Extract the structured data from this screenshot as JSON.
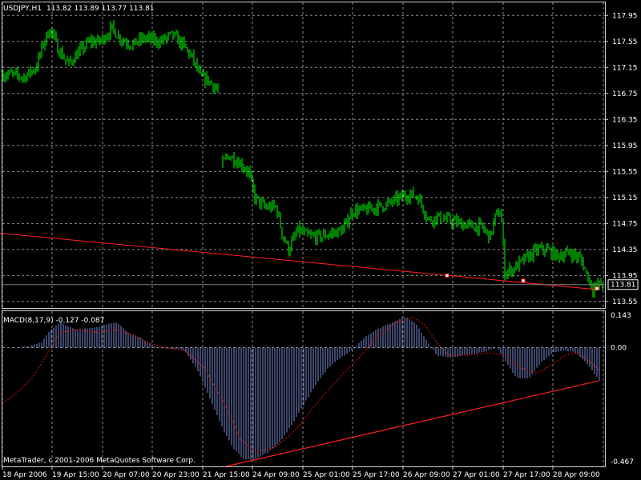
{
  "colors": {
    "background": "#000000",
    "grid": "#8a8a8a",
    "frame": "#cfcfcf",
    "price_bars": "#00ff00",
    "trendline": "#ff2020",
    "macd_histogram": "#7b8bd6",
    "macd_signal": "#e01010",
    "text": "#ffffff"
  },
  "chart_data": [
    {
      "type": "line",
      "title": "USDJPY,H1",
      "ohlc": "113.82 113.89 113.77 113.81",
      "ylim": [
        113.45,
        118.15
      ],
      "y_ticks": [
        "117.95",
        "117.55",
        "117.15",
        "116.75",
        "116.35",
        "115.95",
        "115.55",
        "115.15",
        "114.75",
        "114.35",
        "113.95",
        "113.55"
      ],
      "current_price": "113.81",
      "x_ticks": [
        "18 Apr 2006",
        "19 Apr 15:00",
        "20 Apr 07:00",
        "20 Apr 23:00",
        "21 Apr 15:00",
        "24 Apr 09:00",
        "25 Apr 01:00",
        "25 Apr 17:00",
        "26 Apr 09:00",
        "27 Apr 01:00",
        "27 Apr 17:00",
        "28 Apr 09:00"
      ],
      "grid": true,
      "close_path": [
        [
          0,
          117.03
        ],
        [
          10,
          117.05
        ],
        [
          30,
          117.0
        ],
        [
          45,
          117.15
        ],
        [
          55,
          117.55
        ],
        [
          63,
          117.75
        ],
        [
          72,
          117.45
        ],
        [
          85,
          117.2
        ],
        [
          100,
          117.4
        ],
        [
          112,
          117.55
        ],
        [
          125,
          117.55
        ],
        [
          140,
          117.75
        ],
        [
          150,
          117.6
        ],
        [
          165,
          117.5
        ],
        [
          180,
          117.6
        ],
        [
          200,
          117.55
        ],
        [
          215,
          117.65
        ],
        [
          228,
          117.5
        ],
        [
          240,
          117.3
        ],
        [
          250,
          117.0
        ],
        [
          260,
          116.95
        ],
        [
          272,
          116.8
        ],
        [
          277,
          115.65
        ],
        [
          285,
          115.8
        ],
        [
          298,
          115.7
        ],
        [
          310,
          115.55
        ],
        [
          318,
          115.15
        ],
        [
          330,
          115.0
        ],
        [
          345,
          115.0
        ],
        [
          352,
          114.6
        ],
        [
          360,
          114.35
        ],
        [
          372,
          114.65
        ],
        [
          385,
          114.55
        ],
        [
          400,
          114.55
        ],
        [
          415,
          114.6
        ],
        [
          428,
          114.65
        ],
        [
          440,
          114.95
        ],
        [
          455,
          114.95
        ],
        [
          470,
          115.0
        ],
        [
          485,
          115.05
        ],
        [
          500,
          115.15
        ],
        [
          512,
          115.2
        ],
        [
          522,
          115.15
        ],
        [
          535,
          114.8
        ],
        [
          545,
          114.85
        ],
        [
          560,
          114.8
        ],
        [
          575,
          114.75
        ],
        [
          590,
          114.7
        ],
        [
          600,
          114.7
        ],
        [
          612,
          114.55
        ],
        [
          618,
          114.85
        ],
        [
          625,
          114.95
        ],
        [
          630,
          114.0
        ],
        [
          640,
          114.05
        ],
        [
          655,
          114.2
        ],
        [
          672,
          114.35
        ],
        [
          682,
          114.35
        ],
        [
          695,
          114.25
        ],
        [
          712,
          114.3
        ],
        [
          725,
          114.2
        ],
        [
          733,
          113.95
        ],
        [
          740,
          113.75
        ],
        [
          746,
          113.8
        ],
        [
          752,
          113.82
        ]
      ],
      "trendline": [
        [
          0,
          114.6
        ],
        [
          748,
          113.73
        ]
      ],
      "trend_markers": [
        [
          558,
          113.95
        ],
        [
          653,
          113.87
        ],
        [
          745,
          113.75
        ]
      ]
    },
    {
      "type": "bar",
      "title": "MACD(8,17,9) -0.127 -0.087",
      "ylim": [
        -0.467,
        0.143
      ],
      "y_ticks": [
        "0.143",
        "0.00",
        "-0.467"
      ],
      "histogram_path": [
        [
          3,
          0.0
        ],
        [
          20,
          0.0
        ],
        [
          40,
          0.01
        ],
        [
          52,
          0.02
        ],
        [
          60,
          0.06
        ],
        [
          75,
          0.1
        ],
        [
          95,
          0.07
        ],
        [
          120,
          0.08
        ],
        [
          145,
          0.1
        ],
        [
          160,
          0.06
        ],
        [
          180,
          0.03
        ],
        [
          195,
          0.0
        ],
        [
          230,
          -0.01
        ],
        [
          245,
          -0.08
        ],
        [
          262,
          -0.2
        ],
        [
          278,
          -0.32
        ],
        [
          292,
          -0.4
        ],
        [
          305,
          -0.44
        ],
        [
          318,
          -0.44
        ],
        [
          335,
          -0.41
        ],
        [
          350,
          -0.37
        ],
        [
          365,
          -0.3
        ],
        [
          380,
          -0.22
        ],
        [
          395,
          -0.14
        ],
        [
          410,
          -0.08
        ],
        [
          425,
          -0.04
        ],
        [
          440,
          -0.01
        ],
        [
          455,
          0.04
        ],
        [
          470,
          0.07
        ],
        [
          490,
          0.1
        ],
        [
          505,
          0.12
        ],
        [
          518,
          0.1
        ],
        [
          530,
          0.04
        ],
        [
          545,
          -0.03
        ],
        [
          560,
          -0.04
        ],
        [
          580,
          -0.03
        ],
        [
          600,
          -0.02
        ],
        [
          620,
          0.0
        ],
        [
          632,
          -0.06
        ],
        [
          645,
          -0.12
        ],
        [
          660,
          -0.12
        ],
        [
          675,
          -0.06
        ],
        [
          690,
          -0.02
        ],
        [
          705,
          -0.01
        ],
        [
          718,
          -0.02
        ],
        [
          732,
          -0.06
        ],
        [
          748,
          -0.13
        ]
      ],
      "signal_path": [
        [
          3,
          -0.22
        ],
        [
          20,
          -0.18
        ],
        [
          40,
          -0.12
        ],
        [
          60,
          -0.02
        ],
        [
          75,
          0.06
        ],
        [
          95,
          0.07
        ],
        [
          120,
          0.06
        ],
        [
          145,
          0.07
        ],
        [
          165,
          0.05
        ],
        [
          185,
          0.02
        ],
        [
          205,
          0.0
        ],
        [
          230,
          -0.01
        ],
        [
          255,
          -0.08
        ],
        [
          280,
          -0.22
        ],
        [
          300,
          -0.36
        ],
        [
          320,
          -0.41
        ],
        [
          345,
          -0.39
        ],
        [
          370,
          -0.32
        ],
        [
          395,
          -0.22
        ],
        [
          420,
          -0.13
        ],
        [
          445,
          -0.05
        ],
        [
          470,
          0.04
        ],
        [
          495,
          0.1
        ],
        [
          515,
          0.12
        ],
        [
          530,
          0.09
        ],
        [
          545,
          0.02
        ],
        [
          560,
          -0.03
        ],
        [
          585,
          -0.03
        ],
        [
          610,
          -0.02
        ],
        [
          630,
          -0.03
        ],
        [
          650,
          -0.08
        ],
        [
          670,
          -0.1
        ],
        [
          688,
          -0.07
        ],
        [
          705,
          -0.03
        ],
        [
          720,
          -0.02
        ],
        [
          735,
          -0.05
        ],
        [
          748,
          -0.09
        ]
      ],
      "trendline": [
        [
          282,
          -0.467
        ],
        [
          748,
          -0.13
        ]
      ]
    }
  ],
  "footer": {
    "copyright": "MetaTrader, c 2001-2006 MetaQuotes Software Corp."
  }
}
